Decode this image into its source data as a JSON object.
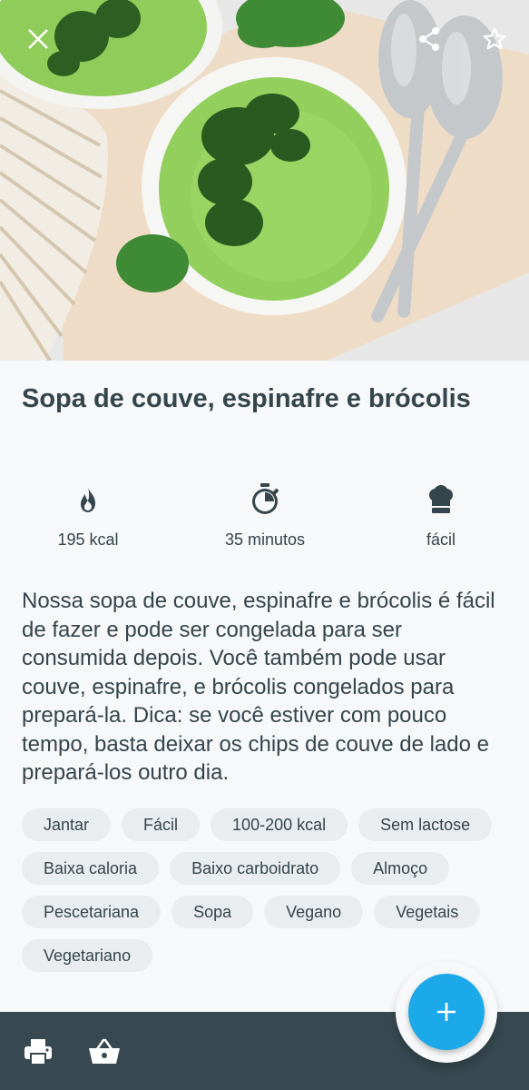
{
  "recipe": {
    "title": "Sopa de couve, espinafre e brócolis",
    "stats": {
      "calories": "195 kcal",
      "time": "35 minutos",
      "difficulty": "fácil"
    },
    "description": "Nossa sopa de couve, espinafre e brócolis é fácil de fazer e pode ser congelada para ser consumida depois. Você também pode usar couve, espinafre, e brócolis congelados para prepará-la. Dica: se você estiver com pouco tempo, basta deixar os chips de couve de lado e prepará-los outro dia.",
    "tags": [
      "Jantar",
      "Fácil",
      "100-200 kcal",
      "Sem lactose",
      "Baixa caloria",
      "Baixo carboidrato",
      "Almoço",
      "Pescetariana",
      "Sopa",
      "Vegano",
      "Vegetais",
      "Vegetariano"
    ]
  },
  "icons": {
    "close": "close-icon",
    "share": "share-icon",
    "favorite": "star-outline-icon",
    "calories": "flame-icon",
    "time": "stopwatch-icon",
    "difficulty": "chef-hat-icon",
    "print": "printer-icon",
    "basket": "shopping-basket-icon",
    "add": "plus-icon"
  },
  "colors": {
    "text": "#35454c",
    "tag_bg": "#e9edf0",
    "bottom_bar": "#374850",
    "fab": "#1ba9ea"
  }
}
